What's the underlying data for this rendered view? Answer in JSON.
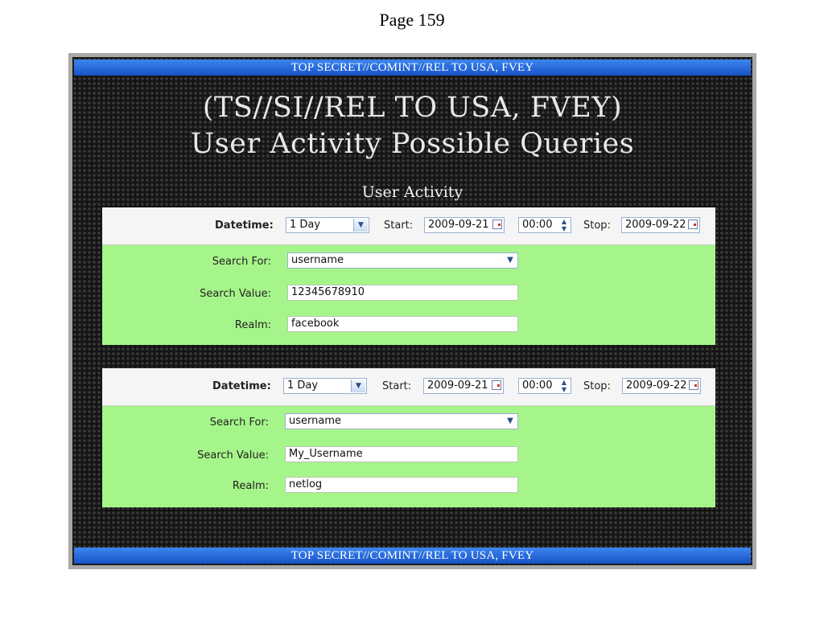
{
  "page": {
    "number_text": "Page 159"
  },
  "slide": {
    "banner_top": "TOP SECRET//COMINT//REL TO USA, FVEY",
    "banner_bottom": "TOP SECRET//COMINT//REL TO USA, FVEY",
    "title_line1": "(TS//SI//REL TO USA, FVEY)",
    "title_line2": "User Activity Possible Queries",
    "subtitle": "User Activity"
  },
  "forms": [
    {
      "datetime_label": "Datetime:",
      "datetime_value": "1 Day",
      "start_label": "Start:",
      "start_date": "2009-09-21",
      "start_time": "00:00",
      "stop_label": "Stop:",
      "stop_date": "2009-09-22",
      "search_for_label": "Search For:",
      "search_for_value": "username",
      "search_value_label": "Search Value:",
      "search_value": "12345678910",
      "realm_label": "Realm:",
      "realm_value": "facebook"
    },
    {
      "datetime_label": "Datetime:",
      "datetime_value": "1 Day",
      "start_label": "Start:",
      "start_date": "2009-09-21",
      "start_time": "00:00",
      "stop_label": "Stop:",
      "stop_date": "2009-09-22",
      "search_for_label": "Search For:",
      "search_for_value": "username",
      "search_value_label": "Search Value:",
      "search_value": "My_Username",
      "realm_label": "Realm:",
      "realm_value": "netlog"
    }
  ],
  "colors": {
    "banner": "#1f5fd6",
    "form_green": "#a6f58a",
    "slide_background": "#151515"
  },
  "icons": [
    "dropdown-arrow-icon",
    "calendar-icon",
    "spinner-arrows-icon"
  ]
}
